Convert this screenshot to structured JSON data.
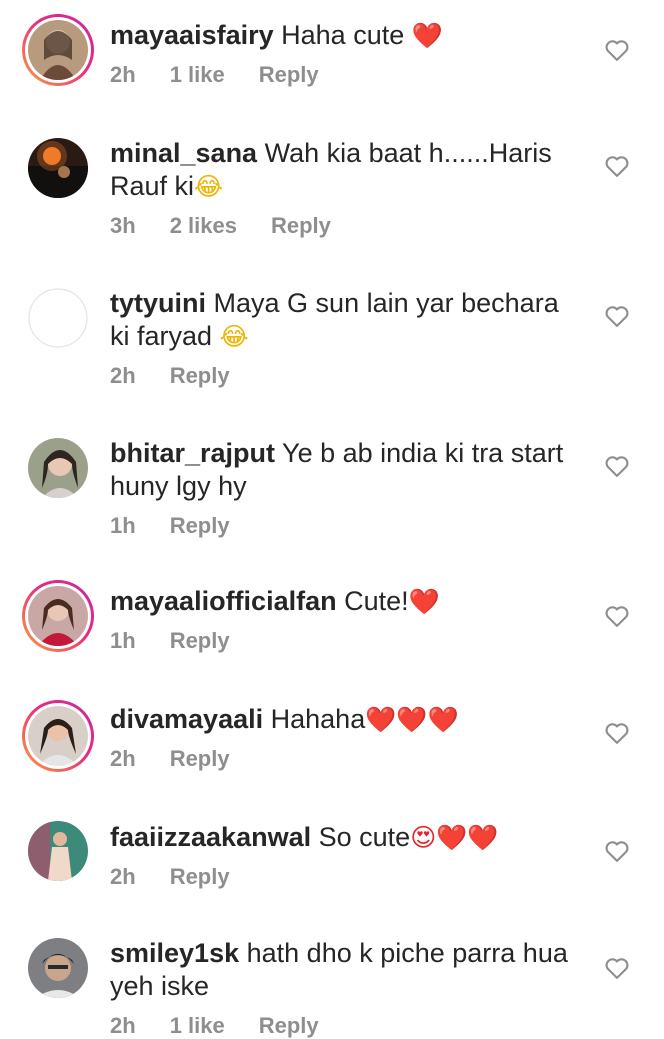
{
  "comments": [
    {
      "username": "mayaaisfairy",
      "text": "Haha cute ",
      "emoji": "❤️",
      "time": "2h",
      "likes": "1 like",
      "reply": "Reply"
    },
    {
      "username": "minal_sana",
      "text": "Wah kia baat h......Haris Rauf ki",
      "emoji": "😂",
      "time": "3h",
      "likes": "2 likes",
      "reply": "Reply"
    },
    {
      "username": "tytyuini",
      "text": "Maya G sun lain yar bechara ki faryad ",
      "emoji": "😂",
      "time": "2h",
      "likes": "",
      "reply": "Reply"
    },
    {
      "username": "bhitar_rajput",
      "text": "Ye b ab india ki tra start huny lgy hy",
      "emoji": "",
      "time": "1h",
      "likes": "",
      "reply": "Reply"
    },
    {
      "username": "mayaaliofficialfan",
      "text": "Cute!",
      "emoji": "❤️",
      "time": "1h",
      "likes": "",
      "reply": "Reply"
    },
    {
      "username": "divamayaali",
      "text": "Hahaha",
      "emoji": "❤️❤️❤️",
      "time": "2h",
      "likes": "",
      "reply": "Reply"
    },
    {
      "username": "faaiizzaakanwal",
      "text": "So cute",
      "emoji": "😍❤️❤️",
      "time": "2h",
      "likes": "",
      "reply": "Reply"
    },
    {
      "username": "smiley1sk",
      "text": "hath dho k piche parra hua yeh iske",
      "emoji": "",
      "time": "2h",
      "likes": "1 like",
      "reply": "Reply"
    }
  ],
  "icons": {
    "like": "heart-outline-icon"
  },
  "colors": {
    "story_ring_start": "#f9a33b",
    "story_ring_end": "#c32aa3",
    "meta_text": "#8e8e8e"
  }
}
